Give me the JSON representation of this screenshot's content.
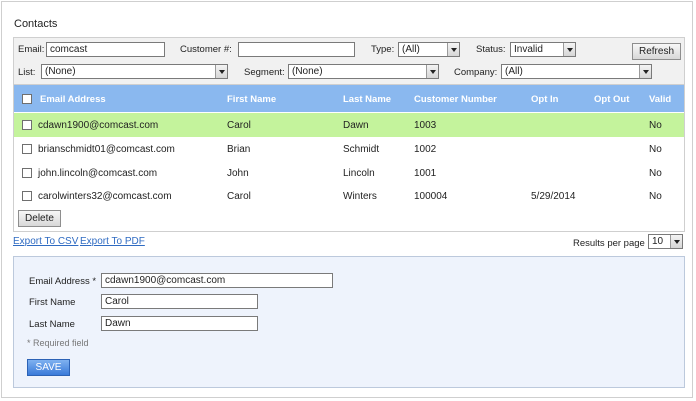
{
  "page": {
    "title": "Contacts"
  },
  "filters": {
    "email_label": "Email:",
    "email_value": "comcast",
    "customer_label": "Customer #:",
    "customer_value": "",
    "type_label": "Type:",
    "type_value": "(All)",
    "status_label": "Status:",
    "status_value": "Invalid",
    "refresh_label": "Refresh",
    "list_label": "List:",
    "list_value": "(None)",
    "segment_label": "Segment:",
    "segment_value": "(None)",
    "company_label": "Company:",
    "company_value": "(All)"
  },
  "table": {
    "headers": {
      "email": "Email Address",
      "first": "First Name",
      "last": "Last Name",
      "number": "Customer Number",
      "optin": "Opt In",
      "optout": "Opt Out",
      "valid": "Valid"
    },
    "rows": [
      {
        "email": "cdawn1900@comcast.com",
        "first": "Carol",
        "last": "Dawn",
        "number": "1003",
        "optin": "",
        "optout": "",
        "valid": "No",
        "selected": true
      },
      {
        "email": "brianschmidt01@comcast.com",
        "first": "Brian",
        "last": "Schmidt",
        "number": "1002",
        "optin": "",
        "optout": "",
        "valid": "No",
        "selected": false
      },
      {
        "email": "john.lincoln@comcast.com",
        "first": "John",
        "last": "Lincoln",
        "number": "1001",
        "optin": "",
        "optout": "",
        "valid": "No",
        "selected": false
      },
      {
        "email": "carolwinters32@comcast.com",
        "first": "Carol",
        "last": "Winters",
        "number": "100004",
        "optin": "5/29/2014",
        "optout": "",
        "valid": "No",
        "selected": false
      }
    ],
    "delete_label": "Delete"
  },
  "exports": {
    "csv": "Export To CSV",
    "pdf": "Export To PDF"
  },
  "pager": {
    "label": "Results per page",
    "value": "10"
  },
  "form": {
    "email_label": "Email Address *",
    "email_value": "cdawn1900@comcast.com",
    "first_label": "First Name",
    "first_value": "Carol",
    "last_label": "Last Name",
    "last_value": "Dawn",
    "required_note": "* Required field",
    "save_label": "SAVE"
  },
  "colors": {
    "header_bg": "#8ab8ef",
    "selected_row": "#c4f39c",
    "link": "#2f6bc2",
    "save_button": "#3a7ad9",
    "form_bg": "#eef3fc"
  }
}
